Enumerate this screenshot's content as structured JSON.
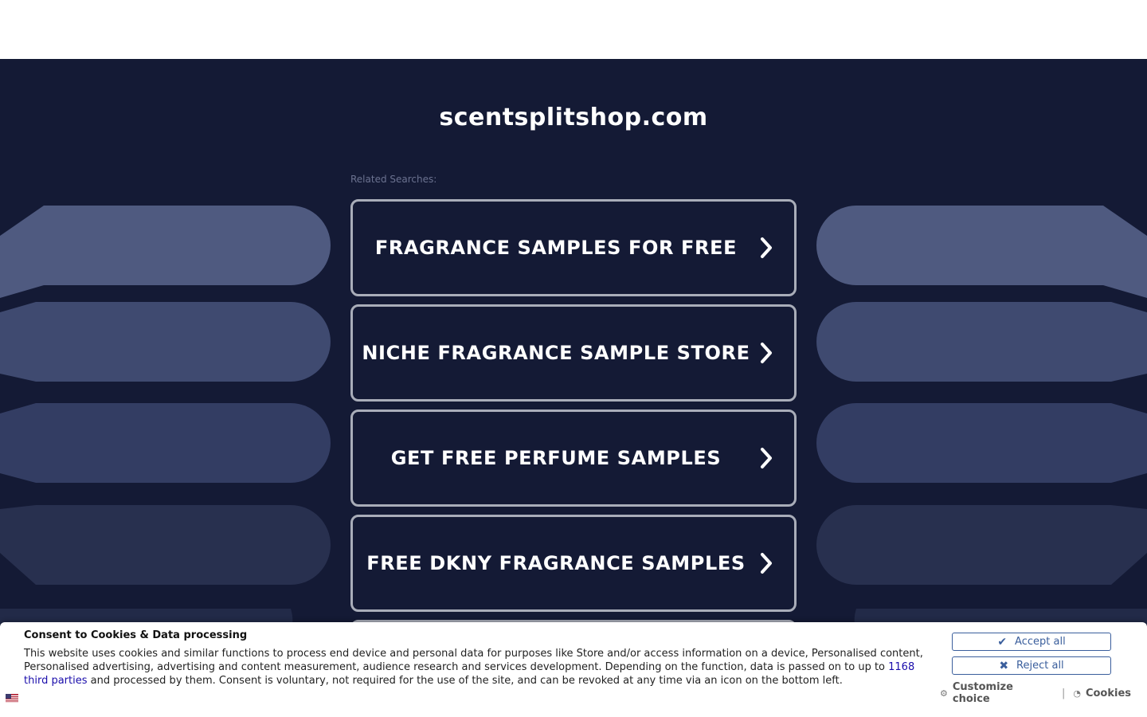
{
  "page": {
    "domain": "scentsplitshop.com",
    "related_label": "Related Searches:"
  },
  "searches": [
    {
      "label": "FRAGRANCE SAMPLES FOR FREE"
    },
    {
      "label": "NICHE FRAGRANCE SAMPLE STORE"
    },
    {
      "label": "GET FREE PERFUME SAMPLES"
    },
    {
      "label": "FREE DKNY FRAGRANCE SAMPLES"
    },
    {
      "label": ""
    }
  ],
  "consent": {
    "title": "Consent to Cookies & Data processing",
    "text_before": "This website uses cookies and similar functions to process end device and personal data for purposes like Store and/or access information on a device, Personalised content, Personalised advertising, advertising and content measurement, audience research and services development. Depending on the function, data is passed on to up to ",
    "link_text": "1168 third parties",
    "text_after": " and processed by them. Consent is voluntary, not required for the use of the site, and can be revoked at any time via an icon on the bottom left.",
    "accept_label": "Accept all",
    "reject_label": "Reject all",
    "customize_label": "Customize choice",
    "separator": "|",
    "cookies_label": "Cookies",
    "language_icon": "us-flag-icon"
  },
  "colors": {
    "background": "#141a35",
    "button_border": "#a9adb9",
    "decor_shape": "#4f5a80",
    "consent_accent": "#3a5e9c",
    "link": "#1a0dab"
  }
}
